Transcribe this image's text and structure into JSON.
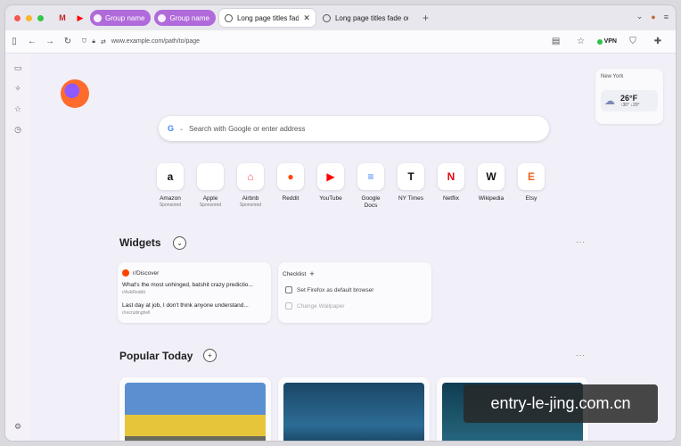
{
  "tabstrip": {
    "traffic_colors": [
      "#f25a51",
      "#f9b52c",
      "#34c748"
    ],
    "pinned": [
      {
        "icon": "gmail-icon",
        "label": "M"
      },
      {
        "icon": "youtube-icon",
        "label": "▶"
      }
    ],
    "groups": [
      {
        "label": "Group name"
      },
      {
        "label": "Group name"
      }
    ],
    "tabs": [
      {
        "title": "Long page titles fade out",
        "active": true
      },
      {
        "title": "Long page titles fade out",
        "active": false
      }
    ],
    "new_tab": "+"
  },
  "toolbar": {
    "url": "www.example.com/path/to/page",
    "vpn_label": "VPN"
  },
  "weather": {
    "city": "New York",
    "temp": "26°F",
    "hilo": "↑30° ↓20°"
  },
  "search": {
    "placeholder": "Search with Google or enter address",
    "engine_glyph": "G"
  },
  "shortcuts": [
    {
      "name": "Amazon",
      "sponsored": "Sponsored",
      "glyph": "a",
      "color": "#111"
    },
    {
      "name": "Apple",
      "sponsored": "Sponsored",
      "glyph": "",
      "color": "#111"
    },
    {
      "name": "Airbnb",
      "sponsored": "Sponsored",
      "glyph": "⌂",
      "color": "#ff5a5f"
    },
    {
      "name": "Reddit",
      "sponsored": "",
      "glyph": "●",
      "color": "#ff4500"
    },
    {
      "name": "YouTube",
      "sponsored": "",
      "glyph": "▶",
      "color": "#ff0000"
    },
    {
      "name": "Google Docs",
      "sponsored": "",
      "glyph": "≡",
      "color": "#4285f4"
    },
    {
      "name": "NY Times",
      "sponsored": "",
      "glyph": "T",
      "color": "#111"
    },
    {
      "name": "Netflix",
      "sponsored": "",
      "glyph": "N",
      "color": "#e50914"
    },
    {
      "name": "Wikipedia",
      "sponsored": "",
      "glyph": "W",
      "color": "#111"
    },
    {
      "name": "Etsy",
      "sponsored": "",
      "glyph": "E",
      "color": "#f1641e"
    }
  ],
  "widgets": {
    "title": "Widgets",
    "reddit": {
      "source": "r/Discover",
      "posts": [
        {
          "title": "What's the most unhinged, batshit crazy predictio...",
          "sub": "r/AskReddit"
        },
        {
          "title": "Last day at job, I don't think anyone understand...",
          "sub": "r/recruitinghell"
        }
      ]
    },
    "checklist": {
      "title": "Checklist",
      "items": [
        {
          "label": "Set Firefox as default browser",
          "faded": false
        },
        {
          "label": "Change Wallpaper",
          "faded": true
        }
      ]
    }
  },
  "popular": {
    "title": "Popular Today"
  },
  "watermark": "entry-le-jing.com.cn"
}
